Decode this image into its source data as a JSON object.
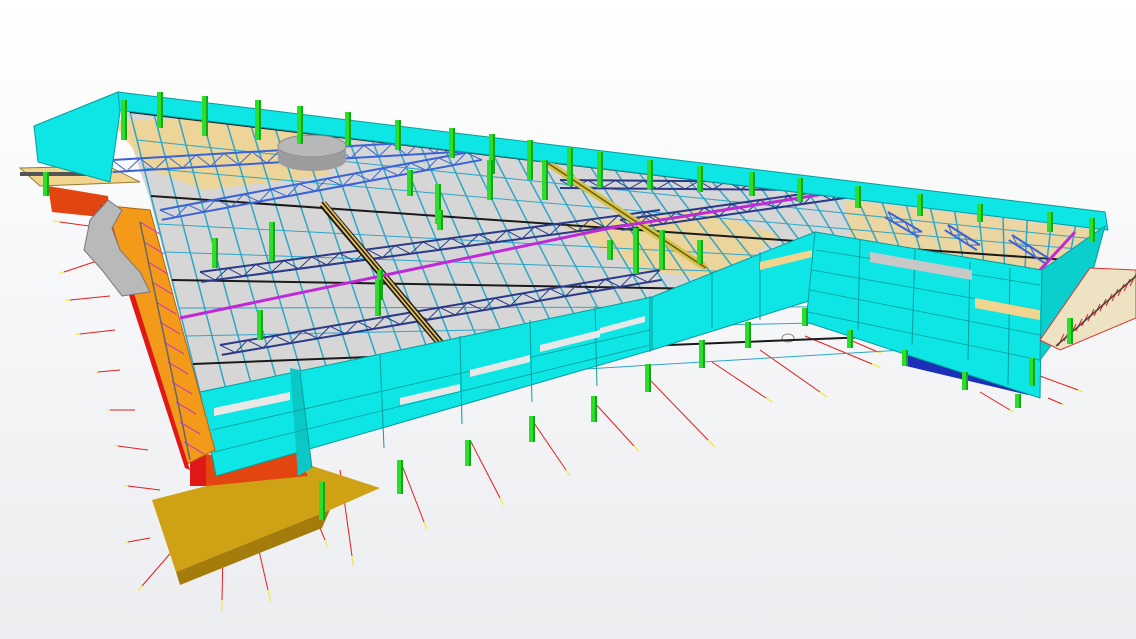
{
  "scene": {
    "background": {
      "top": "#ffffff",
      "bottom": "#ecedf0"
    },
    "colors": {
      "cladding": "#0de6e4",
      "cladding_edge": "#079c9c",
      "column": "#2ddd2c",
      "column_dark": "#17a51a",
      "roof_deck": "#d6d6d6",
      "purlin": "#2fa6c6",
      "truss": "#2a3a88",
      "truss_blue": "#3a63d8",
      "beam_dark": "#1a1a1a",
      "beam_magenta": "#c02ad6",
      "timber": "#f1d48e",
      "orange_wall": "#f39a1a",
      "red": "#e01818",
      "ochre": "#cfa215",
      "grey": "#a8a8a8",
      "navy": "#1c2fb8",
      "white_window": "#e8e8e8",
      "grid_red": "#e02020",
      "grid_yellow": "#f2ea60"
    },
    "icons": [
      "none"
    ]
  }
}
